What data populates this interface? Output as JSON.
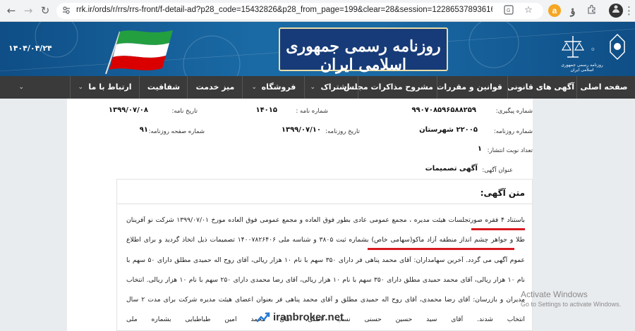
{
  "browser": {
    "url": "rrk.ir/ords/r/rrs/rrs-front/f-detail-ad?p28_code=15432826&p28_from_page=199&clear=28&session=12286537893616&cs=39NmtUczz2G...",
    "back_glyph": "←",
    "forward_glyph": "→",
    "reload_glyph": "↻"
  },
  "banner": {
    "date": "۱۴۰۴/۰۴/۲۴",
    "title": "روزنامه رسمی جمهوری اسلامی ایران",
    "emblem_caption": "روزنامه رسمی جمهوری اسلامی ایران"
  },
  "nav": {
    "items": [
      "صفحه اصلی",
      "آگهی های قانونی",
      "قوانین و مقررات",
      "مشروح مذاکرات مجلس",
      "اشتراک",
      "فروشگاه",
      "میز خدمت",
      "شفافیت",
      "ارتباط با ما"
    ]
  },
  "meta": {
    "tracking_label": "شماره پیگیری:",
    "tracking_value": "۹۹۰۷۰۸۵۹۶۵۸۸۲۵۹",
    "letter_no_label": "شماره نامه :",
    "letter_no_value": "۱۴۰۱۵",
    "letter_date_label": "تاریخ نامه:",
    "letter_date_value": "۱۳۹۹/۰۷/۰۸",
    "newspaper_no_label": "شماره روزنامه:",
    "newspaper_no_value": "۲۲۰۰۵ شهرستان",
    "newspaper_date_label": "تاریخ روزنامه:",
    "newspaper_date_value": "۱۳۹۹/۰۷/۱۰",
    "page_no_label": "شماره صفحه روزنامه:",
    "page_no_value": "۹۱",
    "repeat_label": "تعداد نوبت انتشار:",
    "repeat_value": "۱",
    "ad_title_label": "عنوان آگهی:",
    "ad_title_value": "آگهی تصمیمات"
  },
  "ad": {
    "heading": "متن آگهی:",
    "lines": [
      "باستناد ۴ فقره صورتجلسات هیئت مدیره ، مجمع عمومی عادی بطور فوق العاده و مجمع عمومی فوق العاده مورخ ۱۳۹۹/۰۷/۰۱ شرکت نو آفرینان",
      "طلا و جواهر چشم انداز منطقه آزاد ماکو(سهامی خاص) بشماره ثبت ۳۸۰۵ و شناسه ملی ۱۴۰۰۷۸۲۶۴۰۶ تصمیمات ذیل اتخاذ گردید و برای اطلاع",
      "عموم آگهی می گردد. آخرین سهامداران: آقای محمد پناهی فر دارای ۳۵۰ سهم با نام ۱۰ هزار ریالی، آقای روح اله حمیدی مطلق دارای ۵۰ سهم با",
      "نام ۱۰ هزار ریالی، آقای محمد حمیدی مطلق دارای ۳۵۰ سهم با نام ۱۰ هزار ریالی، آقای رضا محمدی دارای ۲۵۰ سهم با نام ۱۰ هزار ریالی. انتخاب",
      "مدیران و بازرسان: آقای رضا محمدی، آقای روح اله حمیدی مطلق و آقای محمد پناهی فر بعنوان اعضای هیئت مدیره شرکت برای مدت ۲ سال",
      "انتخاب شدند. آقای سید حسین حسنی نسب                                                اصلی، آقای محمد امین طباطبایی بشماره ملی"
    ]
  },
  "overlay": {
    "watermark": "iranbroker.net",
    "activate_title": "Activate Windows",
    "activate_sub": "Go to Settings to activate Windows."
  },
  "colors": {
    "banner_blue": "#1a6aa5",
    "nav_dark": "#3a3a3a",
    "highlight_red": "#d71920"
  }
}
